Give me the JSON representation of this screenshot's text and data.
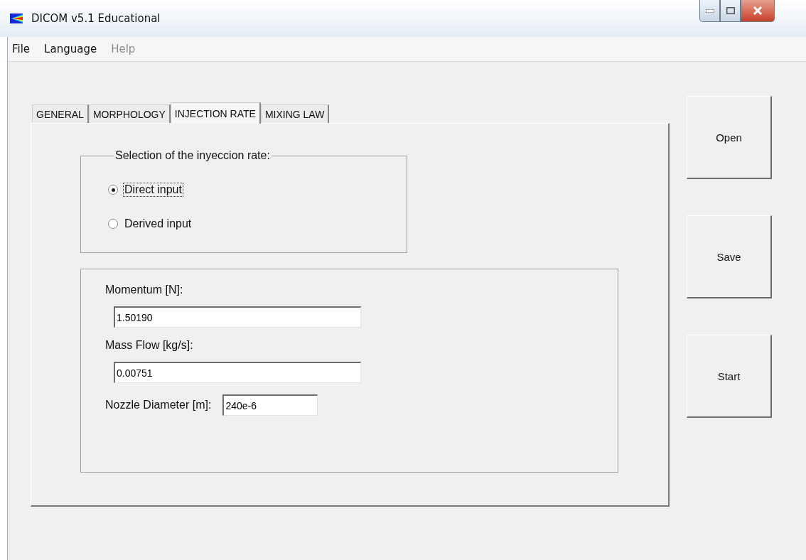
{
  "window": {
    "title": "DICOM v5.1 Educational"
  },
  "menu": [
    {
      "label": "File",
      "disabled": false
    },
    {
      "label": "Language",
      "disabled": false
    },
    {
      "label": "Help",
      "disabled": true
    }
  ],
  "tabs": [
    {
      "label": "GENERAL",
      "selected": false
    },
    {
      "label": "MORPHOLOGY",
      "selected": false
    },
    {
      "label": "INJECTION RATE",
      "selected": true
    },
    {
      "label": "MIXING LAW",
      "selected": false
    }
  ],
  "rate_selection": {
    "title": "Selection of the inyeccion rate:",
    "options": [
      {
        "label": "Direct input",
        "selected": true,
        "focused": true
      },
      {
        "label": "Derived input",
        "selected": false,
        "focused": false
      }
    ]
  },
  "fields": [
    {
      "label": "Momentum [N]:",
      "value": "1.50190",
      "kind": "stacked"
    },
    {
      "label": "Mass Flow [kg/s]:",
      "value": "0.00751",
      "kind": "stacked"
    },
    {
      "label": "Nozzle Diameter [m]:",
      "value": "240e-6",
      "kind": "inline"
    }
  ],
  "buttons": [
    "Open",
    "Save",
    "Start"
  ]
}
